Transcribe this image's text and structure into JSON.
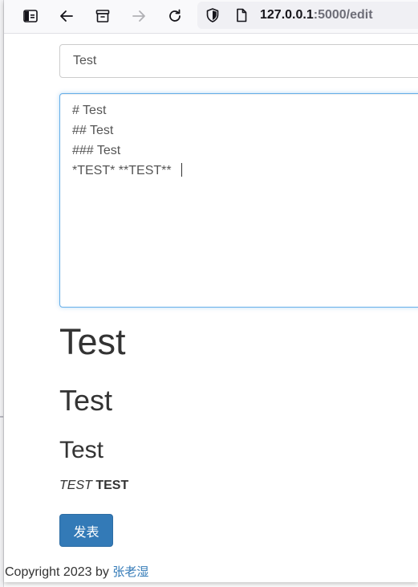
{
  "browser": {
    "url_host": "127.0.0.1",
    "url_rest": ":5000/edit"
  },
  "form": {
    "title_value": "Test",
    "content_lines": "# Test\n## Test\n### Test\n*TEST* **TEST**",
    "submit_label": "发表"
  },
  "preview": {
    "h1": "Test",
    "h2": "Test",
    "h3": "Test",
    "em_text": "TEST",
    "strong_text": "TEST"
  },
  "footer": {
    "copyright": "Copyright 2023 by ",
    "author_link": "张老湿"
  },
  "colors": {
    "accent": "#337ab7",
    "focus_border": "#66afe9"
  }
}
